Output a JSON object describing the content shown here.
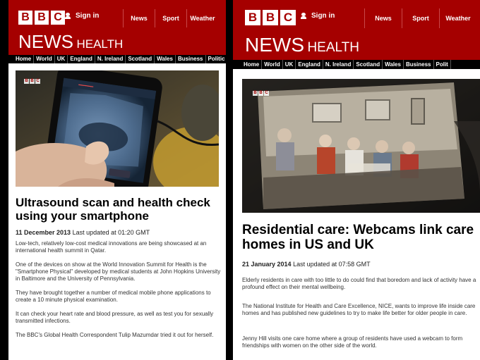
{
  "colors": {
    "bbc_red": "#a50000",
    "subnav_bg": "#000000"
  },
  "panels": [
    {
      "logo": [
        "B",
        "B",
        "C"
      ],
      "sign_in": "Sign in",
      "topnav": [
        "News",
        "Sport",
        "Weather"
      ],
      "brand": {
        "news": "NEWS",
        "section": "HEALTH"
      },
      "subnav": [
        "Home",
        "World",
        "UK",
        "England",
        "N. Ireland",
        "Scotland",
        "Wales",
        "Business",
        "Politic"
      ],
      "watermark": [
        "B",
        "B",
        "C"
      ],
      "headline": "Ultrasound scan and health check using your smartphone",
      "date": "11 December 2013",
      "updated": "Last updated at 01:20 GMT",
      "paragraphs": [
        "Low-tech, relatively low-cost medical innovations are being showcased at an international health summit in Qatar.",
        "One of the devices on show at the World Innovation Summit for Health is the \"Smartphone Physical\" developed by medical students at John Hopkins University in Baltimore and the University of Pennsylvania.",
        "They have brought together a number of medical mobile phone applications to create a 10 minute physical examination.",
        "It can check your heart rate and blood pressure, as well as test you for sexually transmitted infections.",
        "The BBC's Global Health Correspondent Tulip Mazumdar tried it out for herself."
      ]
    },
    {
      "logo": [
        "B",
        "B",
        "C"
      ],
      "sign_in": "Sign in",
      "topnav": [
        "News",
        "Sport",
        "Weather"
      ],
      "brand": {
        "news": "NEWS",
        "section": "HEALTH"
      },
      "subnav": [
        "Home",
        "World",
        "UK",
        "England",
        "N. Ireland",
        "Scotland",
        "Wales",
        "Business",
        "Polit"
      ],
      "watermark": [
        "B",
        "B",
        "C"
      ],
      "headline": "Residential care: Webcams link care homes in US and UK",
      "date": "21 January 2014",
      "updated": "Last updated at 07:58 GMT",
      "paragraphs": [
        "Elderly residents in care with too little to do could find that boredom and lack of activity have a profound effect on their mental wellbeing.",
        "The National Institute for Health and Care Excellence, NICE, wants to improve life inside care homes and has published new guidelines to try to make life better for older people in care.",
        "Jenny Hill visits one care home where a group of residents have used a webcam to form friendships with women on the other side of the world."
      ]
    }
  ]
}
